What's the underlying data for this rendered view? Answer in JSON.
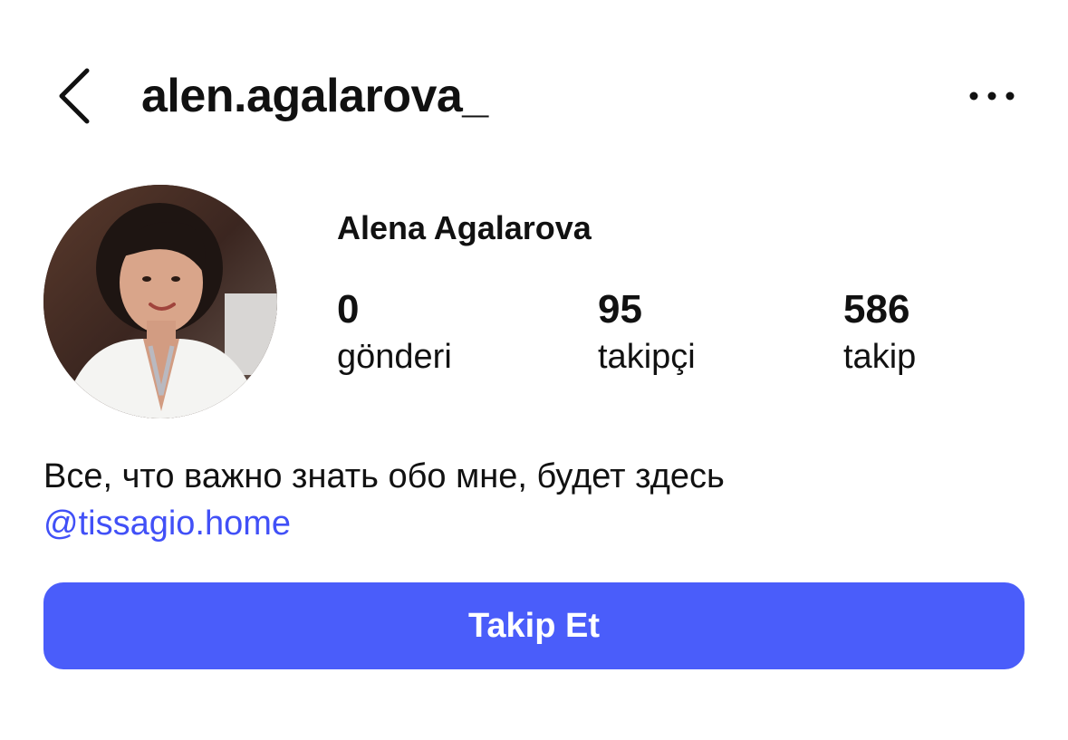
{
  "header": {
    "username": "alen.agalarova_",
    "back_icon": "chevron-left-icon",
    "more_icon": "more-horizontal-icon"
  },
  "profile": {
    "display_name": "Alena Agalarova",
    "avatar": "profile-photo",
    "stats": [
      {
        "value": "0",
        "label": "gönderi"
      },
      {
        "value": "95",
        "label": "takipçi"
      },
      {
        "value": "586",
        "label": "takip"
      }
    ],
    "bio": "Все, что важно знать обо мне, будет здесь",
    "bio_link": "@tissagio.home"
  },
  "actions": {
    "follow_label": "Takip Et"
  },
  "colors": {
    "accent": "#4a5dfa",
    "link": "#4150f7",
    "text": "#111111",
    "background": "#ffffff"
  }
}
